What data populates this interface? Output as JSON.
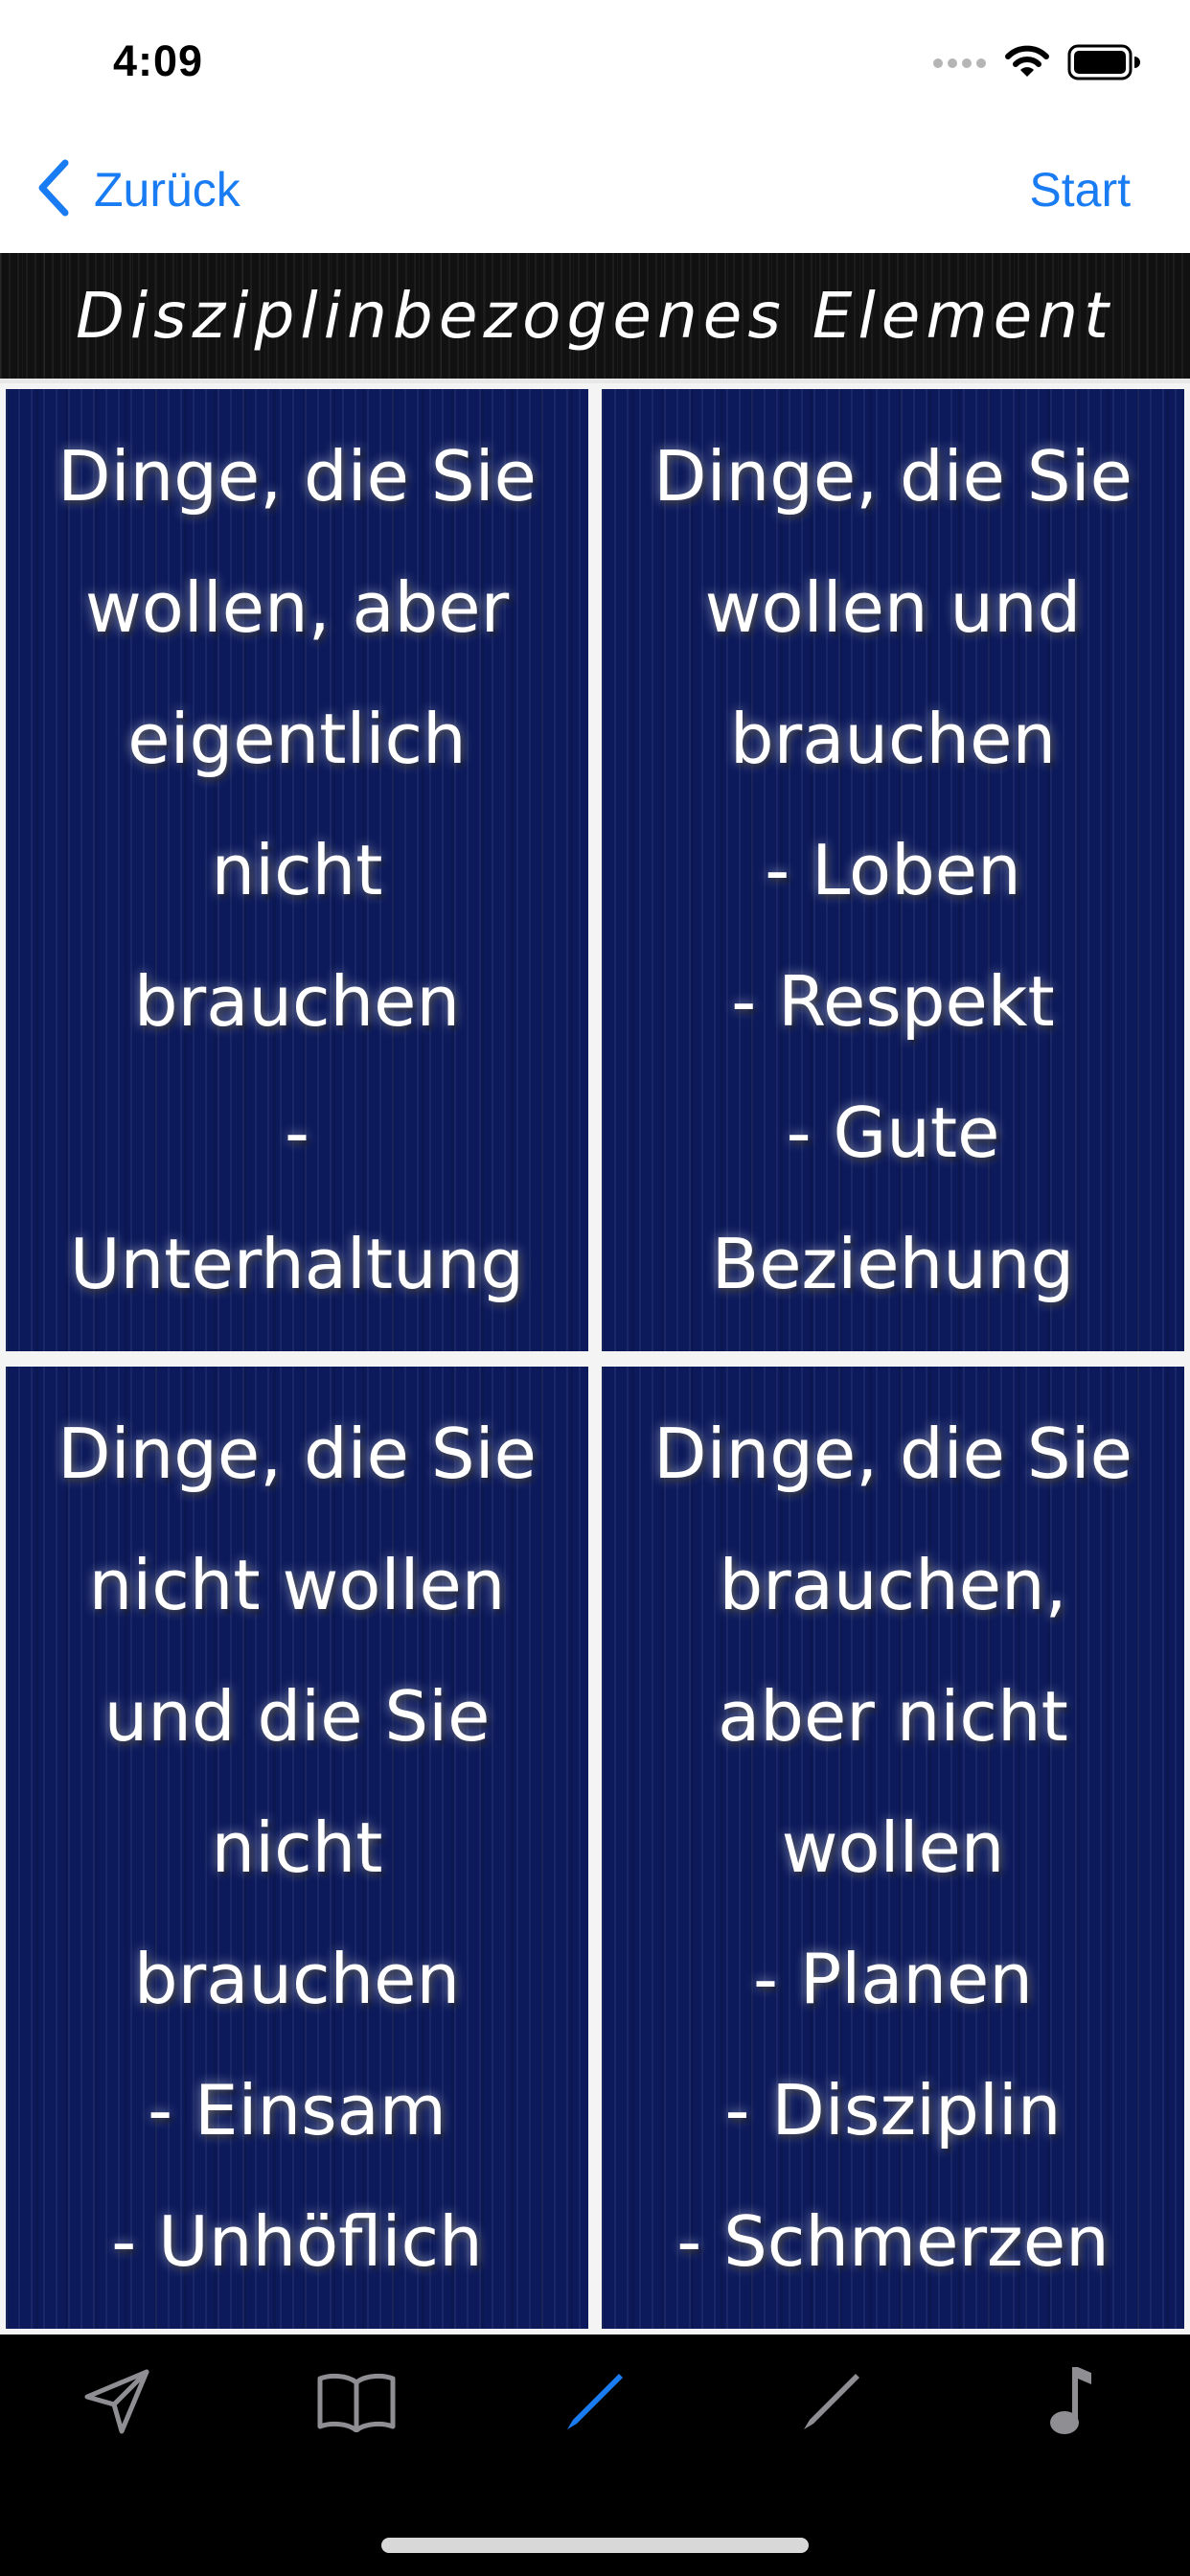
{
  "status_bar": {
    "time": "4:09"
  },
  "nav": {
    "back_label": "Zurück",
    "start_label": "Start"
  },
  "title": "Disziplinbezogenes Element",
  "cards": [
    {
      "text": "Dinge, die Sie\nwollen, aber\neigentlich\nnicht\nbrauchen\n-\nUnterhaltung"
    },
    {
      "text": "Dinge, die Sie\nwollen und\nbrauchen\n- Loben\n- Respekt\n- Gute\nBeziehung"
    },
    {
      "text": "Dinge, die Sie\nnicht wollen\nund die Sie\nnicht\nbrauchen\n- Einsam\n- Unhöflich"
    },
    {
      "text": "Dinge, die Sie\nbrauchen,\naber nicht\nwollen\n- Planen\n- Disziplin\n- Schmerzen"
    }
  ],
  "tabs": [
    {
      "icon": "paper-plane-icon",
      "active": false
    },
    {
      "icon": "book-icon",
      "active": false
    },
    {
      "icon": "pencil-icon",
      "active": true
    },
    {
      "icon": "pencil-icon",
      "active": false
    },
    {
      "icon": "music-note-icon",
      "active": false
    }
  ],
  "colors": {
    "accent": "#1a7cf2",
    "card_background": "#0c1a5c",
    "tab_inactive": "#8e8e93"
  }
}
